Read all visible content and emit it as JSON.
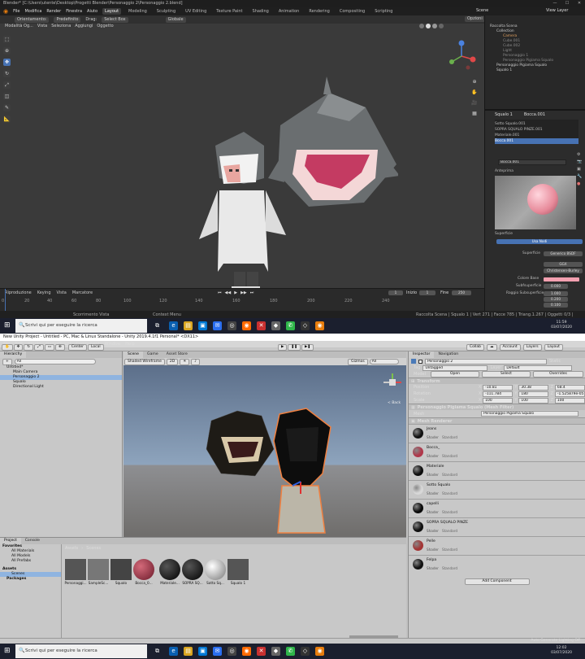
{
  "blender": {
    "title": "Blender* [C:\\Users\\utente\\Desktop\\Progetti Blender\\Personaggio 2\\Personaggio 2.blend]",
    "menus": [
      "File",
      "Modifica",
      "Render",
      "Finestra",
      "Aiuto"
    ],
    "workspaces": [
      "Layout",
      "Modeling",
      "Sculpting",
      "UV Editing",
      "Texture Paint",
      "Shading",
      "Animation",
      "Rendering",
      "Compositing",
      "Scripting"
    ],
    "scene_label": "Scene",
    "view_layer": "View Layer",
    "header": {
      "mode": "Orientamento:",
      "orient": "Predefinito",
      "drag_label": "Drag:",
      "select": "Select Box",
      "global": "Globale",
      "options": "Opzioni"
    },
    "viewport_menu": [
      "Modalità Og...",
      "Vista",
      "Seleziona",
      "Aggiungi",
      "Oggetto"
    ],
    "outliner": {
      "title": "Raccolta Scena",
      "items": [
        "Collection",
        "Camera",
        "Cube.001",
        "Cube.002",
        "Light",
        "Personaggio 1",
        "Personaggio Pigiama Squalo",
        "Personaggio Pigiama Squalo",
        "Squalo 1"
      ]
    },
    "properties": {
      "object": "Squalo 1",
      "mesh": "Bocca.001",
      "slots": [
        "Sotto Squalo.001",
        "SOPRA SQUALO PINZE.001",
        "Materiale.001",
        "Bocca.001"
      ],
      "material": "Bocca.001",
      "preview_label": "Anteprima",
      "surface_label": "Superficie",
      "use_nodes": "Usa Nodi",
      "surface": "Superficie",
      "surface_val": "Generico BSDF",
      "ggx": "GGX",
      "burley": "Christensen-Burley",
      "base_color": "Colore Base",
      "subsurface": "Subfsuperficie",
      "subsurface_val": "0.000",
      "radius_label": "Raggio Subsuperficie",
      "radius": [
        "1.000",
        "0.200",
        "0.100"
      ]
    },
    "timeline": {
      "menu": [
        "Riproduzione",
        "Keying",
        "Vista",
        "Marcatore"
      ],
      "ticks": [
        "0",
        "20",
        "40",
        "60",
        "80",
        "100",
        "120",
        "140",
        "160",
        "180",
        "200",
        "220",
        "240"
      ],
      "current": "1",
      "start_label": "Inizio",
      "start": "1",
      "end_label": "Fine",
      "end": "250"
    },
    "status": {
      "left": "Scorrimento Vista",
      "mid": "Context Menu",
      "right": "Raccolta Scena | Squalo 1 | Vert 271 | Facce 785 | Triang.1.267 | Oggetti 0/3 | Mem: 38.0 MiB | 2.83.1"
    }
  },
  "taskbar1": {
    "search": "Scrivi qui per eseguire la ricerca",
    "time": "11:59",
    "date": "03/07/2020"
  },
  "unity": {
    "title": "New Unity Project - Untitled - PC, Mac & Linux Standalone - Unity 2019.4.1f1 Personal* <DX11>",
    "menus": [
      "File",
      "Edit",
      "Assets",
      "GameObject",
      "Component",
      "Window",
      "Help"
    ],
    "toolbar": {
      "center": "Center",
      "local": "Local",
      "collab": "Collab",
      "account": "Account",
      "layers": "Layers",
      "layout": "Layout"
    },
    "hierarchy": {
      "tab": "Hierarchy",
      "create": "+",
      "search": "All",
      "items": [
        "Untitled*",
        "Main Camera",
        "Personaggio 2",
        "Squalo",
        "Directional Light"
      ]
    },
    "scene": {
      "tabs": [
        "Scene",
        "Game",
        "Asset Store"
      ],
      "shading": "Shaded Wireframe",
      "mode2d": "2D",
      "gizmos": "Gizmos",
      "all": "All",
      "persp": "< Back"
    },
    "inspector": {
      "tabs": [
        "Inspector",
        "Navigation"
      ],
      "object": "Personaggio 2",
      "static": "Static",
      "tag_label": "Tag",
      "tag": "Untagged",
      "layer_label": "Layer",
      "layer": "Default",
      "model_label": "Model",
      "open": "Open",
      "select": "Select",
      "overrides": "Overrides",
      "transform": "Transform",
      "position_label": "Position",
      "position": [
        "-10.81",
        "30.38",
        "68.4"
      ],
      "rotation_label": "Rotation",
      "rotation": [
        "-111.784",
        "180",
        "-1.525879e-05"
      ],
      "scale_label": "Scale",
      "scale": [
        "100",
        "100",
        "100"
      ],
      "mesh_filter": "Personaggio Pigiama Squalo (Mesh Filter)",
      "mesh_label": "Mesh",
      "mesh": "Personaggio Pigiama Squalo",
      "mesh_renderer": "Mesh Renderer",
      "shader_label": "Shader",
      "shader": "Standard",
      "materials": [
        {
          "name": "Jeans",
          "color": "#111111"
        },
        {
          "name": "Bocca_",
          "color": "#b0374a"
        },
        {
          "name": "Materiale",
          "color": "#0d0d0d"
        },
        {
          "name": "Sotto Squalo",
          "color": "#d8d8d8"
        },
        {
          "name": "capelli",
          "color": "#0a0a0a"
        },
        {
          "name": "SOPRA SQUALO PINZE",
          "color": "#0f0f0f"
        },
        {
          "name": "Pelle",
          "color": "#a33434"
        },
        {
          "name": "Felpa",
          "color": "#111111"
        }
      ],
      "add_component": "Add Component",
      "lighting": "Auto Generate Lighting Off"
    },
    "project": {
      "tabs": [
        "Project",
        "Console"
      ],
      "favorites": "Favorites",
      "fav_items": [
        "All Materials",
        "All Models",
        "All Prefabs"
      ],
      "assets": "Assets",
      "folders": [
        "Scenes",
        "Packages"
      ],
      "path": [
        "Assets",
        "Scenes"
      ],
      "assets_list": [
        "Personaggi...",
        "SampleSc...",
        "Squalo",
        "Bocca_0...",
        "Materiale...",
        "SOPRA SQ...",
        "Sotto Sq...",
        "Squalo 1"
      ]
    }
  },
  "taskbar2": {
    "search": "Scrivi qui per eseguire la ricerca",
    "time": "12:02",
    "date": "03/07/2020"
  },
  "colors": {
    "blender_accent": "#4772b3",
    "base_color": "#f2a0b0",
    "unity_selection": "#8fb4e0",
    "taskbar": "#1b1f2e"
  }
}
